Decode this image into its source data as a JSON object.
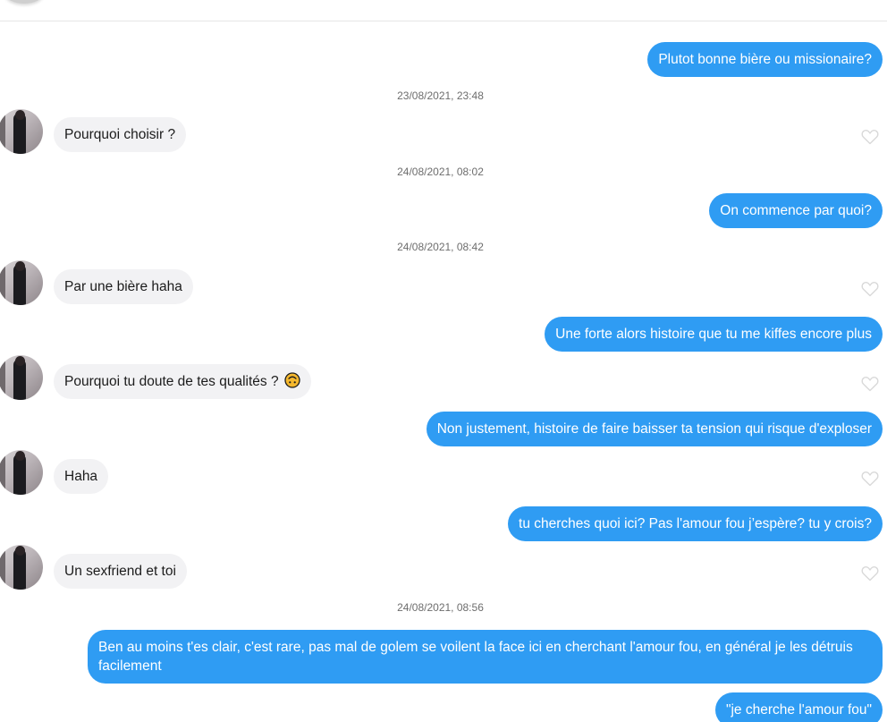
{
  "conversation": {
    "messages": [
      {
        "type": "sent",
        "text": "Plutot bonne bière ou missionaire?"
      },
      {
        "type": "timestamp",
        "text": "23/08/2021, 23:48"
      },
      {
        "type": "received",
        "text": "Pourquoi choisir ?"
      },
      {
        "type": "timestamp",
        "text": "24/08/2021, 08:02"
      },
      {
        "type": "sent",
        "text": "On commence par quoi?"
      },
      {
        "type": "timestamp",
        "text": "24/08/2021, 08:42"
      },
      {
        "type": "received",
        "text": "Par une bière haha"
      },
      {
        "type": "sent",
        "text": "Une forte alors histoire que tu me kiffes encore plus"
      },
      {
        "type": "received",
        "text": "Pourquoi tu doute de tes qualités ?",
        "emoji": "upside-down-face"
      },
      {
        "type": "sent",
        "text": "Non justement, histoire de faire baisser ta tension qui risque d'exploser"
      },
      {
        "type": "received",
        "text": "Haha"
      },
      {
        "type": "sent",
        "text": "tu cherches quoi ici? Pas l'amour fou j’espère? tu y crois?"
      },
      {
        "type": "received",
        "text": "Un sexfriend et toi"
      },
      {
        "type": "timestamp",
        "text": "24/08/2021, 08:56"
      },
      {
        "type": "sent",
        "text": "Ben au moins t'es clair, c'est rare, pas mal de golem se voilent la face ici en cherchant l'amour fou, en général je les détruis facilement"
      },
      {
        "type": "sent",
        "text": "\"je cherche l'amour fou\""
      }
    ]
  },
  "colors": {
    "sent_bubble": "#2f9cf3",
    "received_bubble": "#f2f2f4",
    "emoji": "#f5b82e"
  },
  "icons": {
    "like": "heart-outline-icon",
    "avatar": "contact-avatar"
  }
}
